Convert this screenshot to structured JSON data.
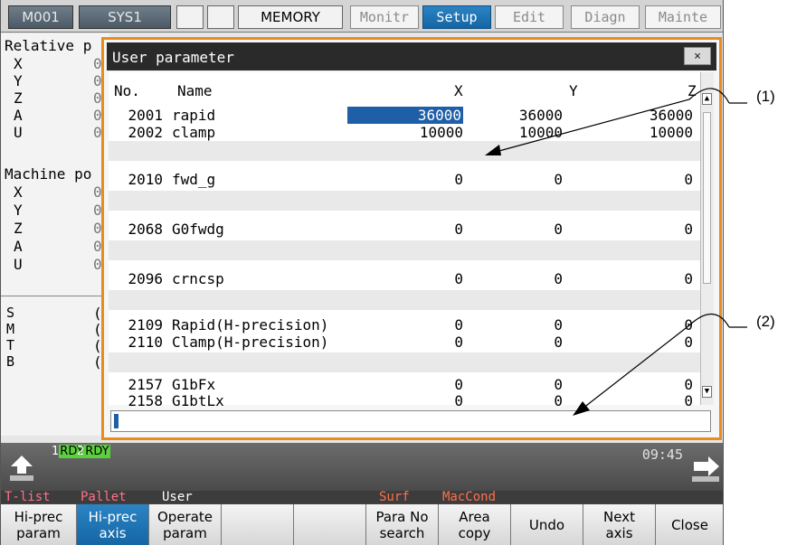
{
  "topbar": {
    "system_tabs": [
      "M001",
      "SYS1",
      "",
      "",
      "MEMORY"
    ],
    "mode_tabs": [
      {
        "label": "Monitr",
        "active": false
      },
      {
        "label": "Setup",
        "active": true
      },
      {
        "label": "Edit",
        "active": false
      },
      {
        "label": "Diagn",
        "active": false
      },
      {
        "label": "Mainte",
        "active": false
      }
    ]
  },
  "left_panel": {
    "relative_heading": "Relative p",
    "relative_axes": [
      "X",
      "Y",
      "Z",
      "A",
      "U"
    ],
    "relative_values": [
      "0",
      "0",
      "0",
      "0",
      "0"
    ],
    "machine_heading": "Machine po",
    "machine_axes": [
      "X",
      "Y",
      "Z",
      "A",
      "U"
    ],
    "machine_values": [
      "0",
      "0",
      "0",
      "0",
      "0"
    ],
    "modal_labels": [
      "S",
      "M",
      "T",
      "B"
    ],
    "modal_values": [
      "(",
      "(",
      "(",
      "("
    ]
  },
  "dialog": {
    "title": "User parameter",
    "close_label": "×",
    "columns": {
      "no": "No.",
      "name": "Name",
      "x": "X",
      "y": "Y",
      "z": "Z"
    },
    "rows": [
      {
        "no": "2001",
        "name": "rapid",
        "x": "36000",
        "y": "36000",
        "z": "36000"
      },
      {
        "no": "2002",
        "name": "clamp",
        "x": "10000",
        "y": "10000",
        "z": "10000"
      },
      {
        "no": "2010",
        "name": "fwd_g",
        "x": "0",
        "y": "0",
        "z": "0"
      },
      {
        "no": "2068",
        "name": "G0fwdg",
        "x": "0",
        "y": "0",
        "z": "0"
      },
      {
        "no": "2096",
        "name": "crncsp",
        "x": "0",
        "y": "0",
        "z": "0"
      },
      {
        "no": "2109",
        "name": "Rapid(H-precision)",
        "x": "0",
        "y": "0",
        "z": "0"
      },
      {
        "no": "2110",
        "name": "Clamp(H-precision)",
        "x": "0",
        "y": "0",
        "z": "0"
      },
      {
        "no": "2157",
        "name": "G1bFx",
        "x": "0",
        "y": "0",
        "z": "0"
      },
      {
        "no": "2158",
        "name": "G1btLx",
        "x": "0",
        "y": "0",
        "z": "0"
      }
    ],
    "selected_row": 0,
    "selected_column": "x",
    "input_value": ""
  },
  "status": {
    "channels": [
      {
        "num": "1",
        "state": "RDY"
      },
      {
        "num": "2",
        "state": "RDY"
      }
    ],
    "time": "09:45"
  },
  "menu_labels": [
    "T-list",
    "Pallet",
    "User",
    "Surf",
    "MacCond"
  ],
  "softkeys": [
    {
      "label": "Hi-prec\nparam",
      "active": false
    },
    {
      "label": "Hi-prec\naxis",
      "active": true
    },
    {
      "label": "Operate\nparam",
      "active": false
    },
    {
      "label": "",
      "active": false
    },
    {
      "label": "",
      "active": false
    },
    {
      "label": "Para No\nsearch",
      "active": false
    },
    {
      "label": "Area\ncopy",
      "active": false
    },
    {
      "label": "Undo",
      "active": false
    },
    {
      "label": "Next\naxis",
      "active": false
    },
    {
      "label": "Close",
      "active": false
    }
  ],
  "callouts": [
    "(1)",
    "(2)"
  ]
}
